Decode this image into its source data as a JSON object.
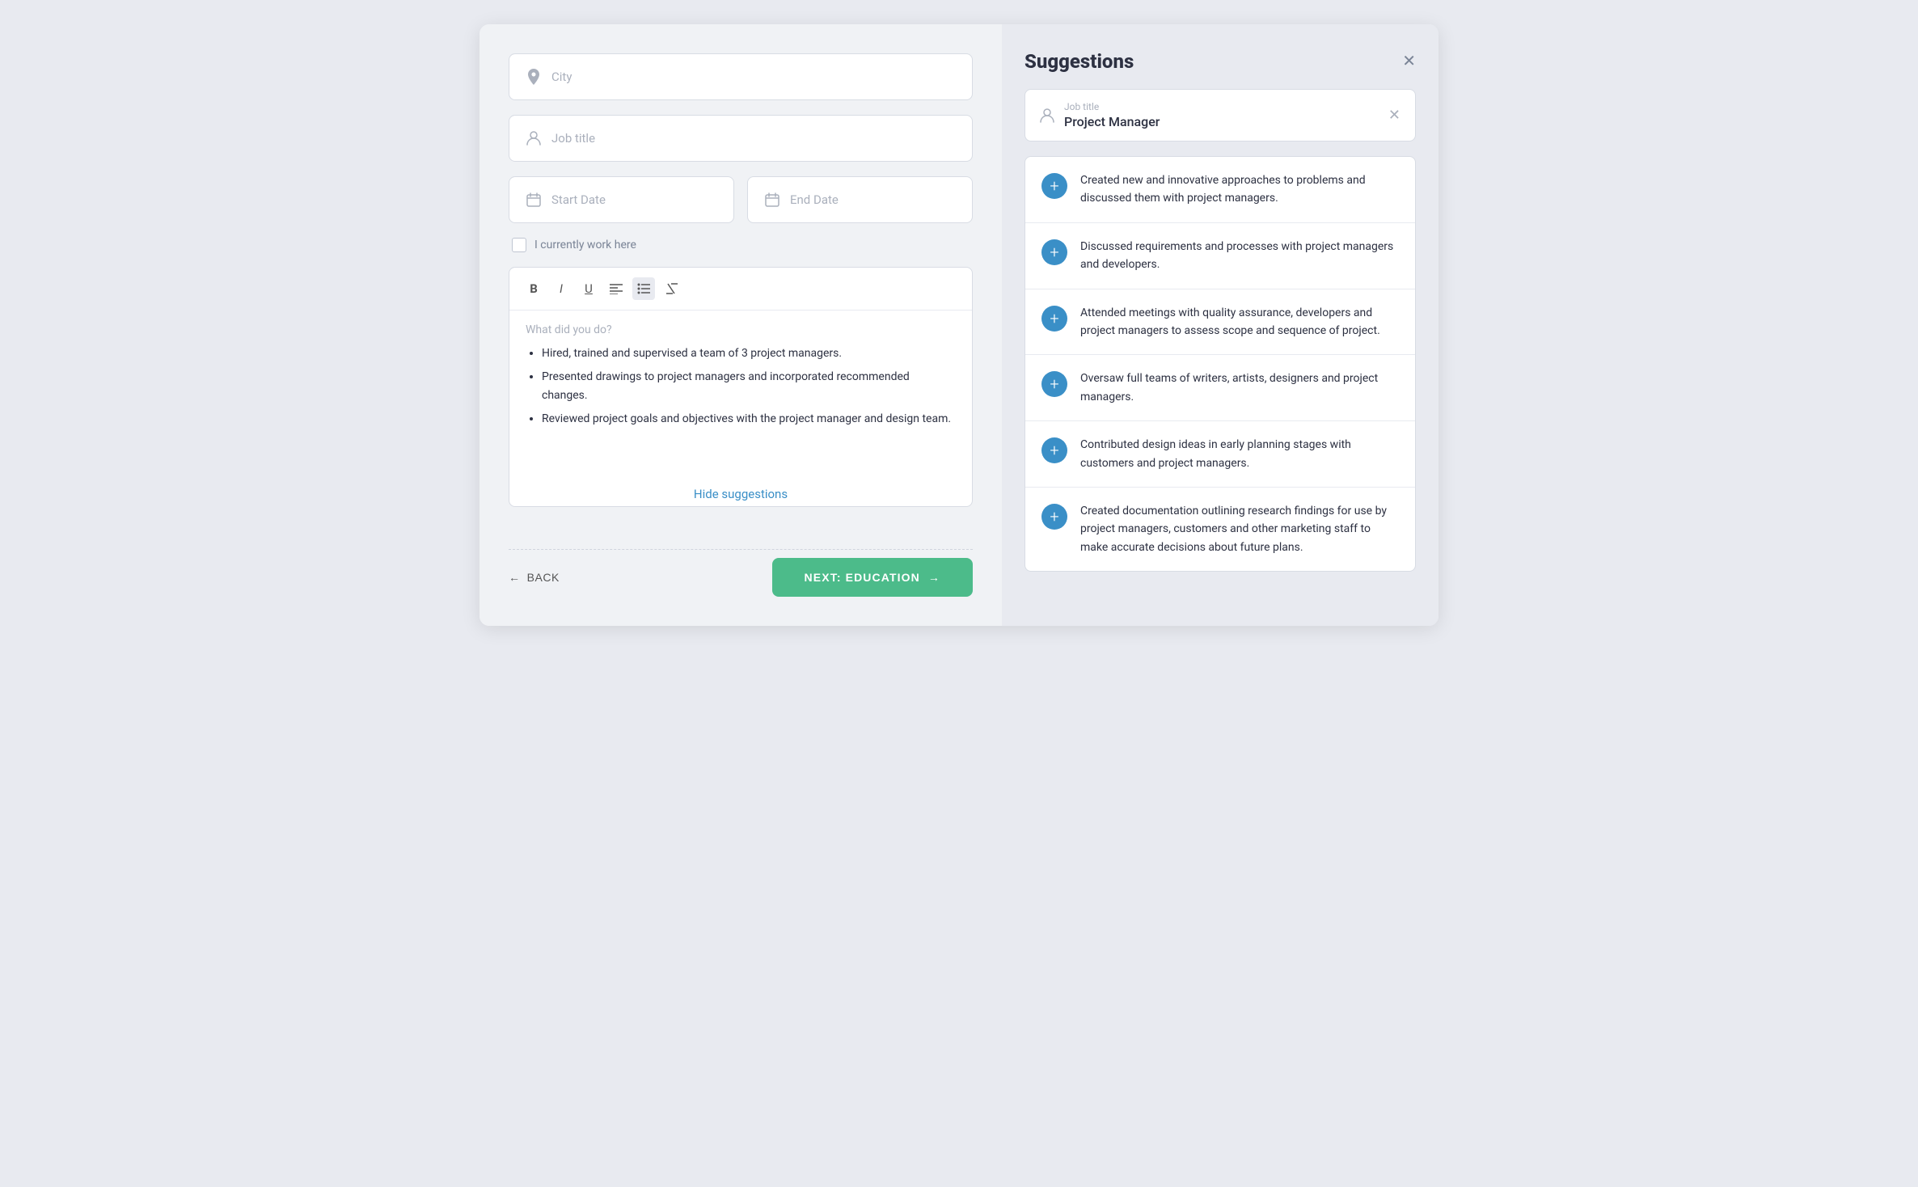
{
  "leftPanel": {
    "cityField": {
      "placeholder": "City"
    },
    "jobTitleField": {
      "placeholder": "Job title"
    },
    "startDateField": {
      "placeholder": "Start Date"
    },
    "endDateField": {
      "placeholder": "End Date"
    },
    "currentlyWorkHere": {
      "label": "I currently work here"
    },
    "editor": {
      "placeholder": "What did you do?",
      "bullets": [
        "Hired, trained and supervised a team of 3 project managers.",
        "Presented drawings to project managers and incorporated recommended changes.",
        "Reviewed project goals and objectives with the project manager and design team."
      ]
    },
    "hideSuggestions": {
      "label": "Hide suggestions"
    },
    "backButton": {
      "label": "BACK"
    },
    "nextButton": {
      "label": "NEXT: EDUCATION"
    }
  },
  "rightPanel": {
    "title": "Suggestions",
    "jobTitle": {
      "sublabel": "Job title",
      "value": "Project Manager"
    },
    "suggestions": [
      {
        "text": "Created new and innovative approaches to problems and discussed them with project managers."
      },
      {
        "text": "Discussed requirements and processes with project managers and developers."
      },
      {
        "text": "Attended meetings with quality assurance, developers and project managers to assess scope and sequence of project."
      },
      {
        "text": "Oversaw full teams of writers, artists, designers and project managers."
      },
      {
        "text": "Contributed design ideas in early planning stages with customers and project managers."
      },
      {
        "text": "Created documentation outlining research findings for use by project managers, customers and other marketing staff to make accurate decisions about future plans."
      }
    ]
  }
}
